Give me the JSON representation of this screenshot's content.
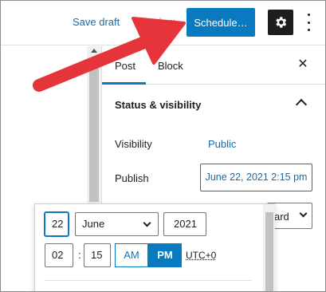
{
  "header": {
    "save_draft": "Save draft",
    "preview": "Preview",
    "schedule": "Schedule…",
    "settings_icon": "gear-icon",
    "options_icon": "kebab-vertical-icon"
  },
  "sidebar": {
    "tabs": [
      {
        "label": "Post",
        "active": true
      },
      {
        "label": "Block",
        "active": false
      }
    ],
    "close_icon": "close-icon",
    "panel_title": "Status & visibility",
    "visibility_label": "Visibility",
    "visibility_value": "Public",
    "publish_label": "Publish",
    "publish_value": "June 22, 2021 2:15 pm",
    "partial_select_value": "ard"
  },
  "datepicker": {
    "day": "22",
    "month": "June",
    "year": "2021",
    "hour": "02",
    "colon": ":",
    "minute": "15",
    "am": "AM",
    "pm": "PM",
    "selected_period": "PM",
    "timezone": "UTC+0"
  },
  "colors": {
    "accent": "#0a7ac0",
    "arrow": "#e5353a"
  }
}
